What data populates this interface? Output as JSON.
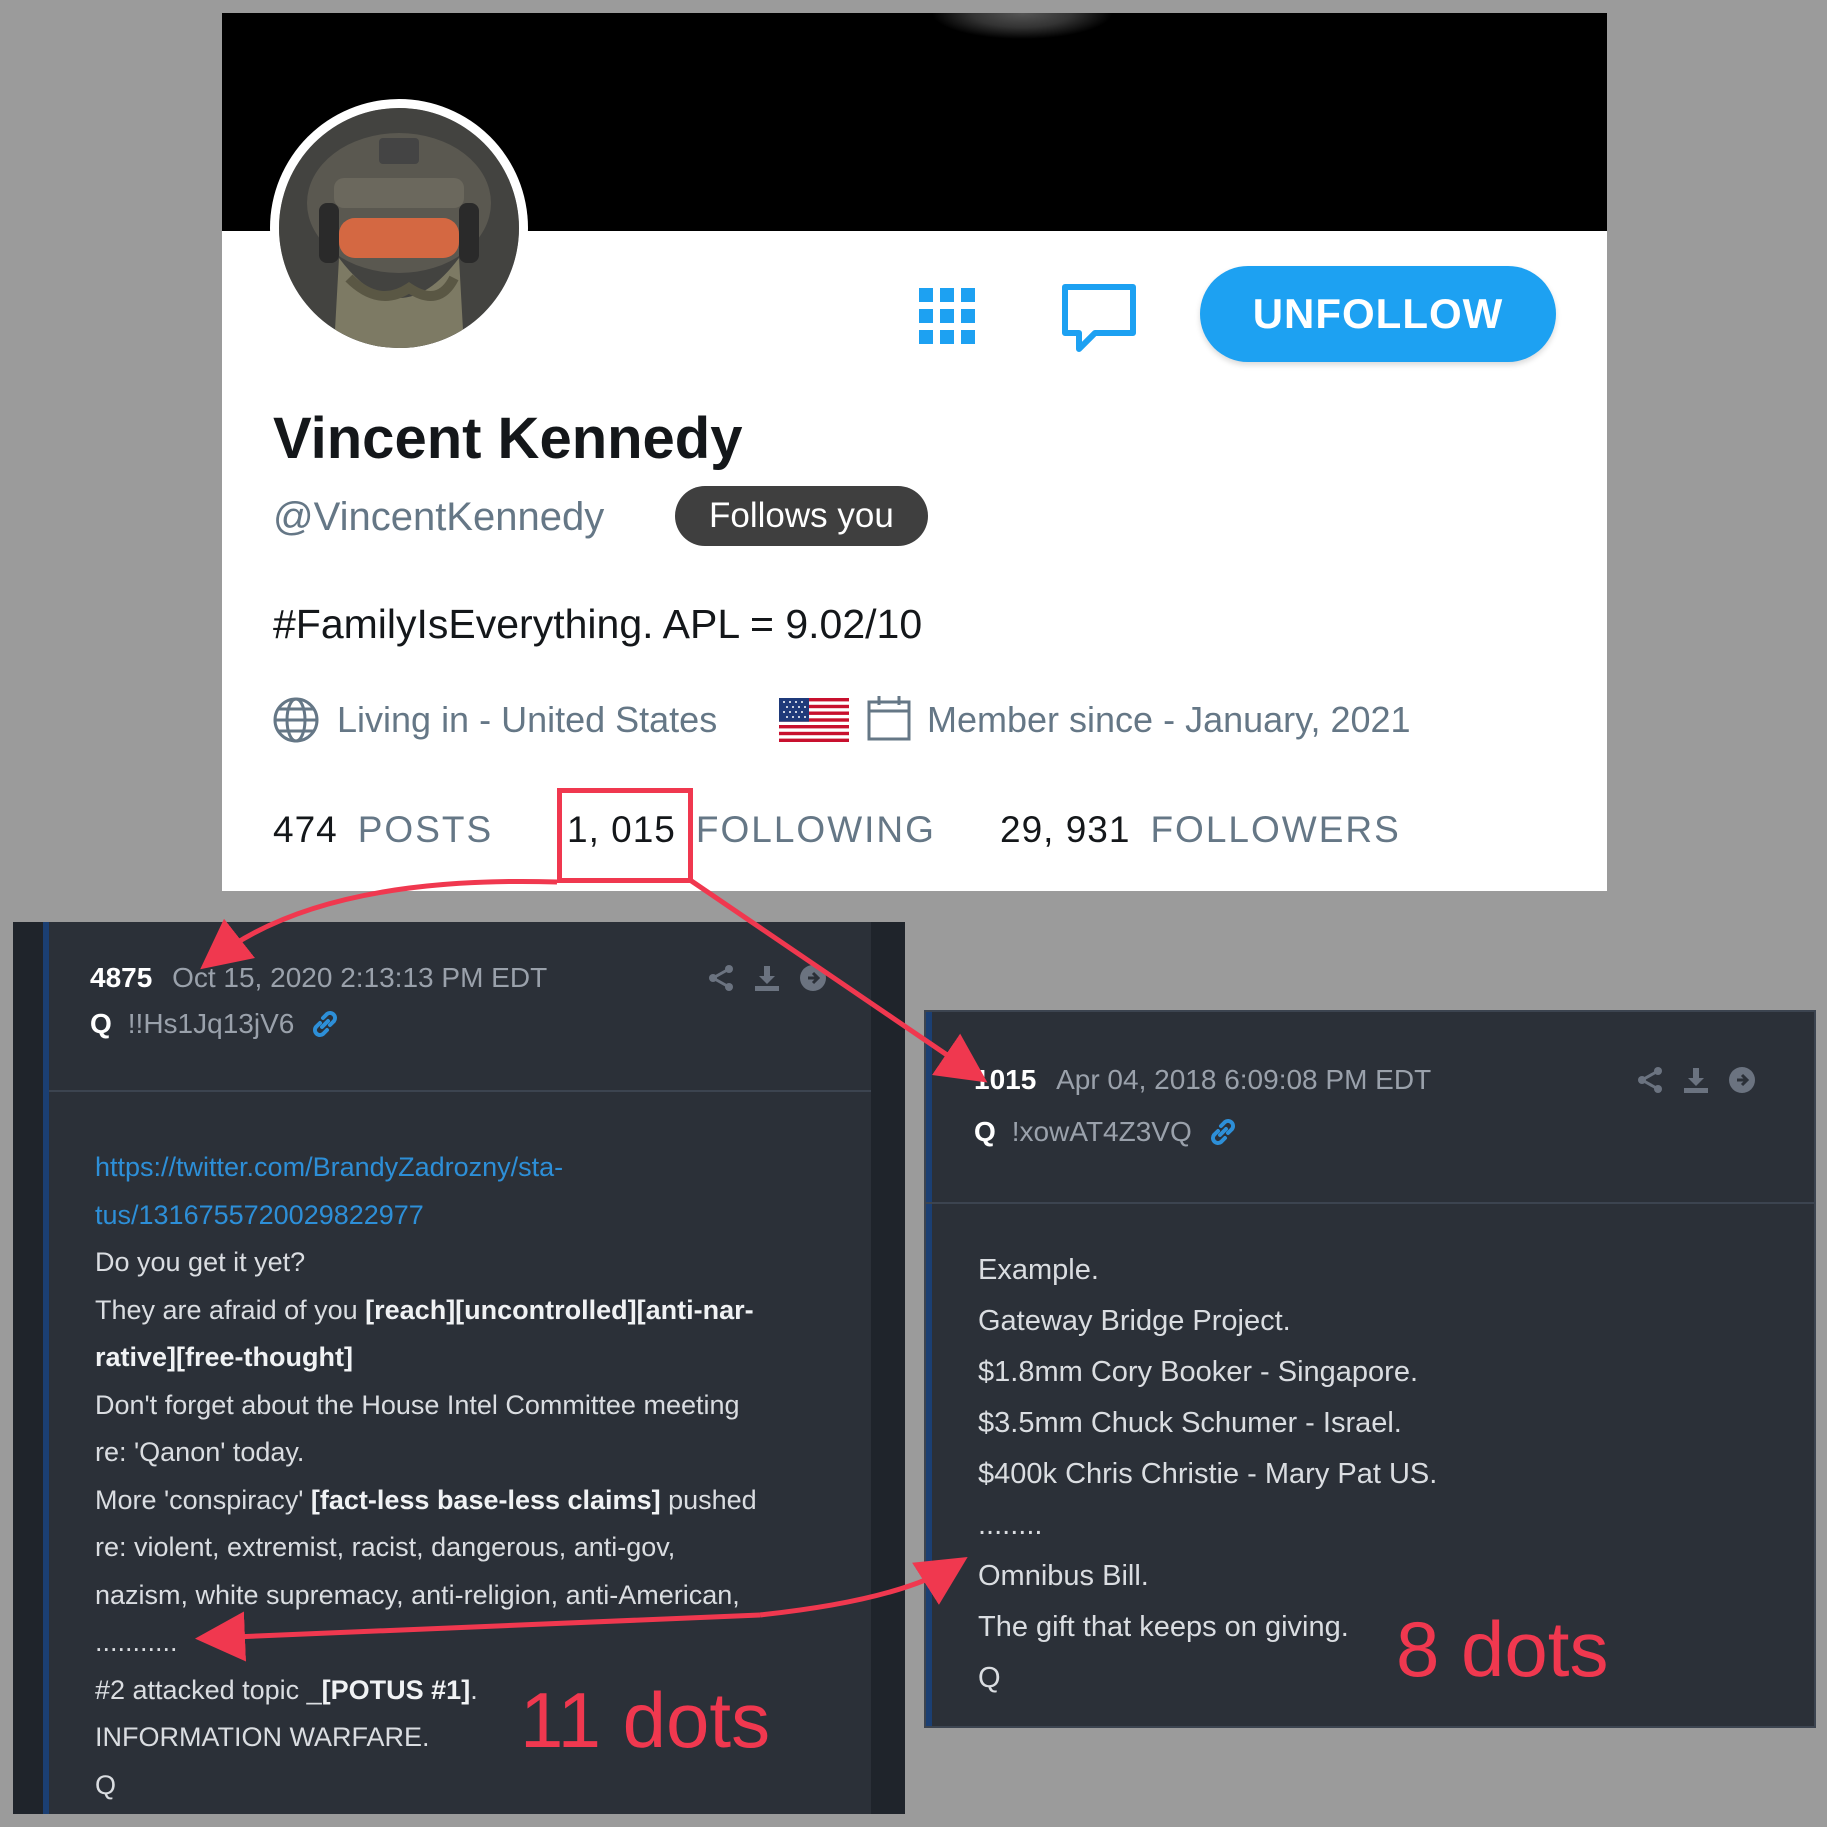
{
  "profile": {
    "display_name": "Vincent Kennedy",
    "handle": "@VincentKennedy",
    "follows_you": "Follows you",
    "unfollow_label": "UNFOLLOW",
    "bio": "#FamilyIsEverything. APL = 9.02/10",
    "location": "Living in - United States",
    "member_since": "Member since - January, 2021",
    "stats": {
      "posts_count": "474",
      "posts_label": "POSTS",
      "following_count": "1, 015",
      "following_label": "FOLLOWING",
      "followers_count": "29, 931",
      "followers_label": "FOLLOWERS"
    },
    "accent_color": "#1da1f2"
  },
  "post_left": {
    "number": "4875",
    "date": "Oct 15, 2020 2:13:13 PM EDT",
    "author": "Q",
    "tripcode": "!!Hs1Jq13jV6",
    "link_line1": "https://twitter.com/BrandyZadrozny/sta-",
    "link_line2": "tus/1316755720029822977",
    "l1": "Do you get it yet?",
    "l2a": "They are afraid of you ",
    "l2b": "[reach][uncontrolled][anti-nar-",
    "l3": "rative][free-thought]",
    "l4": "Don't forget about the House Intel Committee meeting",
    "l5": "re: 'Qanon' today.",
    "l6a": "More 'conspiracy' ",
    "l6b": "[fact-less base-less claims]",
    "l6c": " pushed",
    "l7": "re: violent, extremist, racist, dangerous, anti-gov,",
    "l8": "nazism, white supremacy, anti-religion, anti-American,",
    "l9": "...........",
    "l10a": "#2 attacked topic _",
    "l10b": "[POTUS #1]",
    "l10c": ".",
    "l11": "INFORMATION WARFARE.",
    "l12": "Q"
  },
  "post_right": {
    "number": "1015",
    "date": "Apr 04, 2018 6:09:08 PM EDT",
    "author": "Q",
    "tripcode": "!xowAT4Z3VQ",
    "l1": "Example.",
    "l2": "Gateway Bridge Project.",
    "l3": "$1.8mm Cory Booker - Singapore.",
    "l4": "$3.5mm Chuck Schumer - Israel.",
    "l5": "$400k Chris Christie - Mary Pat US.",
    "l6": "........",
    "l7": "Omnibus Bill.",
    "l8": "The gift that keeps on giving.",
    "l9": "Q"
  },
  "annotations": {
    "left_label": "11 dots",
    "right_label": "8 dots",
    "color": "#f0384f"
  }
}
